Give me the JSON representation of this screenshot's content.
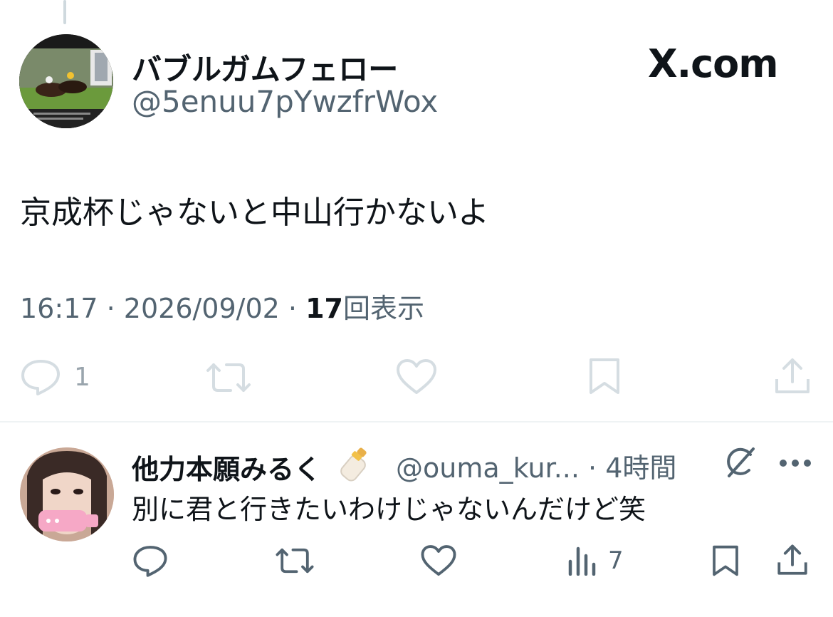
{
  "header": {
    "brand": "X.com"
  },
  "main_post": {
    "display_name": "バブルガムフェロー",
    "handle": "@5enuu7pYwzfrWox",
    "text": "京成杯じゃないと中山行かないよ",
    "time": "16:17",
    "date": "2026/09/02",
    "views_count": "17",
    "views_label": "回表示",
    "separator": "·",
    "actions": {
      "reply_count": "1"
    }
  },
  "reply": {
    "display_name": "他力本願みるく",
    "handle": "@ouma_kur...",
    "separator": "·",
    "time": "4時間",
    "text": "別に君と行きたいわけじゃないんだけど笑",
    "actions": {
      "views_count": "7"
    }
  }
}
